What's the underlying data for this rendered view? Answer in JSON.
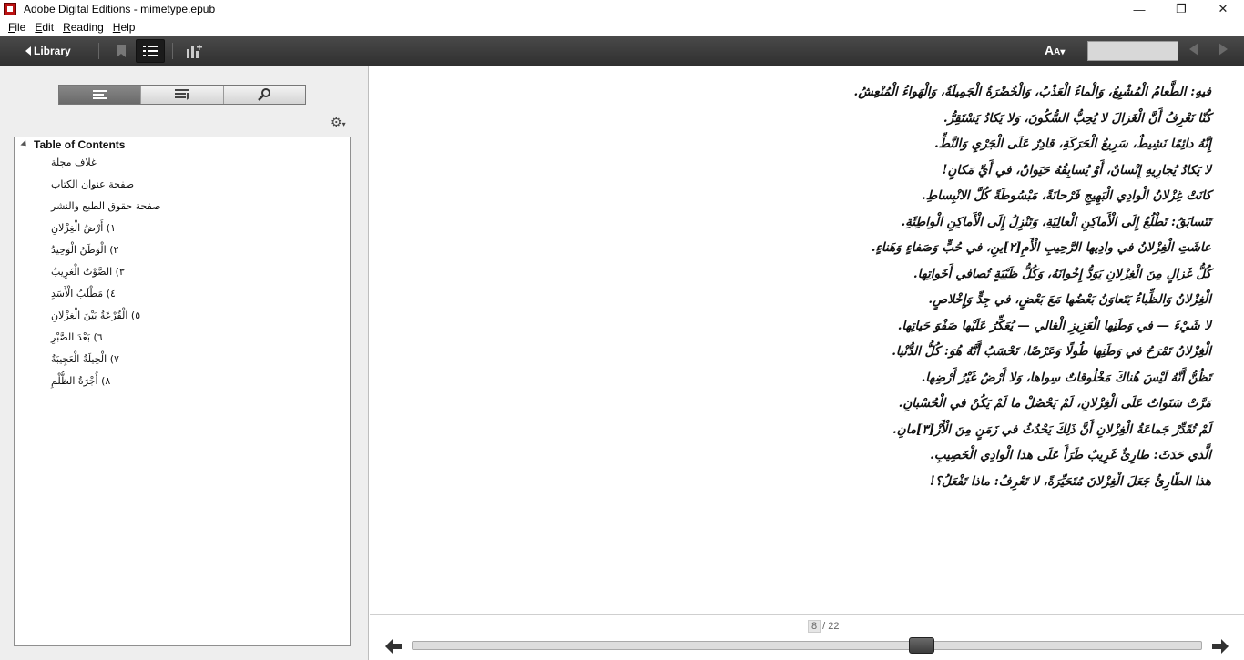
{
  "window": {
    "title": "Adobe Digital Editions - mimetype.epub",
    "minimize": "—",
    "maximize": "❐",
    "close": "✕"
  },
  "menu": [
    {
      "label": "File",
      "accel": "F",
      "rest": "ile"
    },
    {
      "label": "Edit",
      "accel": "E",
      "rest": "dit"
    },
    {
      "label": "Reading",
      "accel": "R",
      "rest": "eading"
    },
    {
      "label": "Help",
      "accel": "H",
      "rest": "elp"
    }
  ],
  "toolbar": {
    "library_label": "Library",
    "font_label": "A",
    "font_label_small": "A",
    "page_input_value": "",
    "icons": [
      "bookmark-icon",
      "toc-list-icon",
      "add-chart-icon"
    ]
  },
  "sidebar": {
    "tabs": [
      "toc-tab",
      "bookmarks-tab",
      "search-tab"
    ],
    "toc_title": "Table of Contents",
    "toc_items": [
      "غلاف مجلة",
      "صفحة عنوان الكتاب",
      "صفحة حقوق الطبع والنشر",
      "١) أَرْضُ الْغِزْلانِ",
      "٢) الْوَطَنُ الْوَحِيدُ",
      "٣) الصَّوْتُ الْغَرِيبُ",
      "٤) مَطْلَبُ الْأَسَدِ",
      "٥) الْقُرْعَةُ بَيْنَ الْغِزْلانِ",
      "٦) بَعْدَ الصَّبْرِ",
      "٧) الْحِيلَةُ الْعَجِيبَةُ",
      "٨) أُجْرَةُ الظُّلْمِ"
    ]
  },
  "reader": {
    "lines": [
      "فيهِ: الطَّعامُ الْمُشْبِعُ، وَالْماءُ الْعَذْبُ، وَالْخُضْرَةُ الْجَمِيلَةُ، وَالْهَواءُ الْمُنْعِشُ.",
      "كُنّا نَعْرِفُ أَنَّ الْغَزالَ لا يُحِبُّ السُّكُونَ، وَلا يَكادُ يَسْتَقِرُّ.",
      "إِنَّهُ دائِمًا نَشِيطٌ، سَرِيعُ الْحَرَكَةِ، قادِرٌ عَلَى الْجَرْيِ وَالنَّطِّ.",
      "لا يَكادُ يُجارِيهِ إِنْسانٌ، أَوْ يُسابِقُهُ حَيَوانٌ، في أَيِّ مَكانٍ!",
      "كانَتْ غِزْلانُ الْوادِي الْبَهِيجِ فَرْحانَةً، مَبْسُوطَةً كُلَّ الانْبِساطِ.",
      "تَتَسابَقُ: تَطْلُعُ إِلَى الْأَماكِنِ الْعالِيَةِ، وَتَنْزِلُ إِلَى الْأَماكِنِ الْواطِئَةِ.",
      "عاشَتِ الْغِزْلانُ في وادِيها الرَّحِيبِ الْأَمِ[٢]ينِ، في حُبٍّ وَصَفاءٍ وَهَناءٍ.",
      "كُلُّ غَزالٍ مِنَ الْغِزْلانِ يَوَدُّ إِخْوانَهُ، وَكُلُّ ظَبْيَةٍ تُصافي أَخَواتِها.",
      "الْغِزْلانُ وَالظِّباءُ يَتَعاوَنُ بَعْضُها مَعَ بَعْضٍ، في جِدٍّ وَإِخْلاصٍ.",
      "لا شَيْءَ — في وَطَنِها الْعَزِيزِ الْغالي — يُعَكِّرُ عَلَيْها صَفْوَ حَياتِها.",
      "الْغِزْلانُ تَمْرَحُ في وَطَنِها طُولًا وَعَرْضًا، تَحْسَبُ أَنَّهُ هُوَ: كُلُّ الدُّنْيا.",
      "تَظُنُّ أَنَّهُ لَيْسَ هُناكَ مَخْلُوقاتٌ سِواها، وَلا أَرْضٌ غَيْرُ أَرْضِها.",
      "مَرَّتْ سَنَواتٌ عَلَى الْغِزْلانِ، لَمْ يَحْصُلْ ما لَمْ يَكُنْ في الْحُسْبانِ.",
      "لَمْ تُقَدِّرْ جَماعَةُ الْغِزْلانِ أَنَّ ذَلِكَ يَحْدُثُ في زَمَنٍ مِنَ الْأَزْ[٣]مانِ.",
      "الَّذي حَدَثَ: طارِئٌ غَرِيبٌ طَرَأَ عَلَى هذا الْوادِي الْخَصِيبِ.",
      "هذا الطّارِئُ جَعَلَ الْغِزْلانَ مُتَحَيِّرَةً، لا تَعْرِفُ: ماذا تَفْعَلُ؟!"
    ]
  },
  "pager": {
    "current": "8",
    "total": "/ 22",
    "progress_fraction": 0.65
  },
  "colors": {
    "toolbar": "#3a3a3a",
    "sidebar_bg": "#eeeeee",
    "slider_thumb": "#4a4a4a"
  }
}
